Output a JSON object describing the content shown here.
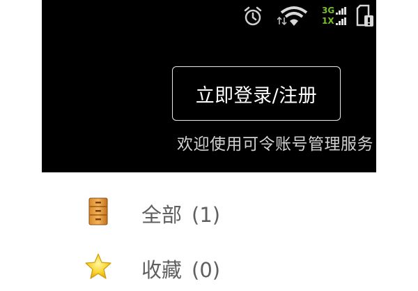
{
  "status_bar": {
    "network_top": "3G",
    "network_bottom": "1X",
    "icons": [
      "alarm-icon",
      "wifi-icon",
      "signal-icon",
      "sim-alert-icon"
    ]
  },
  "header": {
    "login_button": "立即登录/注册",
    "welcome_text": "欢迎使用可令账号管理服务"
  },
  "list": {
    "items": [
      {
        "label": "全部",
        "count": "(1)",
        "icon": "cabinet-icon"
      },
      {
        "label": "收藏",
        "count": "(0)",
        "icon": "star-icon"
      }
    ]
  },
  "colors": {
    "header_bg": "#000000",
    "network_green": "#79c02a",
    "list_text": "#5f5f5f"
  }
}
